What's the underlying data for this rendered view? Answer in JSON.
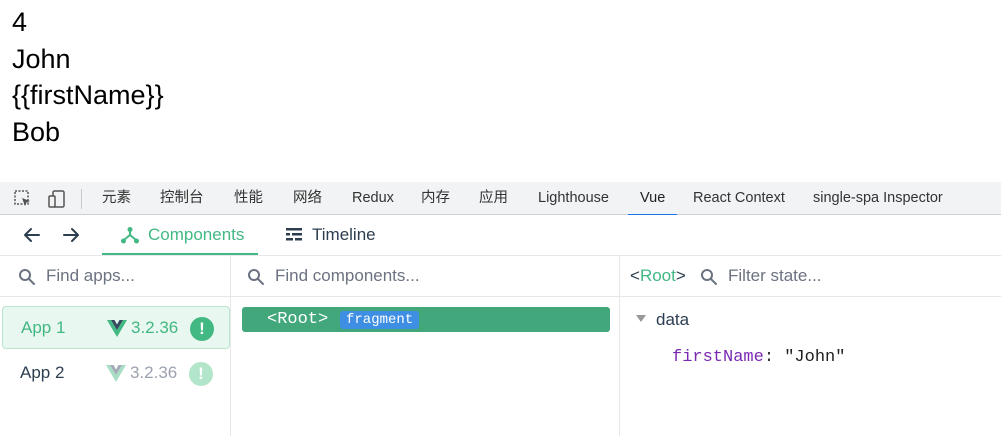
{
  "page": {
    "lines": [
      "4",
      "John",
      "{{firstName}}",
      "Bob"
    ]
  },
  "devtools": {
    "tabs": [
      "元素",
      "控制台",
      "性能",
      "网络",
      "Redux",
      "内存",
      "应用",
      "Lighthouse",
      "Vue",
      "React Context",
      "single-spa Inspector"
    ],
    "active_tab": "Vue"
  },
  "vue": {
    "tabs": {
      "components": "Components",
      "timeline": "Timeline"
    },
    "active_tab": "Components",
    "apps": {
      "search_placeholder": "Find apps...",
      "items": [
        {
          "name": "App 1",
          "version": "3.2.36",
          "selected": true
        },
        {
          "name": "App 2",
          "version": "3.2.36",
          "selected": false
        }
      ]
    },
    "tree": {
      "search_placeholder": "Find components...",
      "root": {
        "tag": "<Root>",
        "badge": "fragment"
      }
    },
    "state": {
      "root_prefix": "<",
      "root_name": "Root",
      "root_suffix": ">",
      "filter_placeholder": "Filter state...",
      "section": "data",
      "entries": [
        {
          "key": "firstName",
          "value": "\"John\""
        }
      ]
    }
  },
  "colors": {
    "vue_green": "#42b883",
    "selected_node": "#42a87c",
    "badge_blue": "#3e8ee3",
    "devtools_active": "#1a73e8",
    "key_purple": "#7b28b2"
  }
}
